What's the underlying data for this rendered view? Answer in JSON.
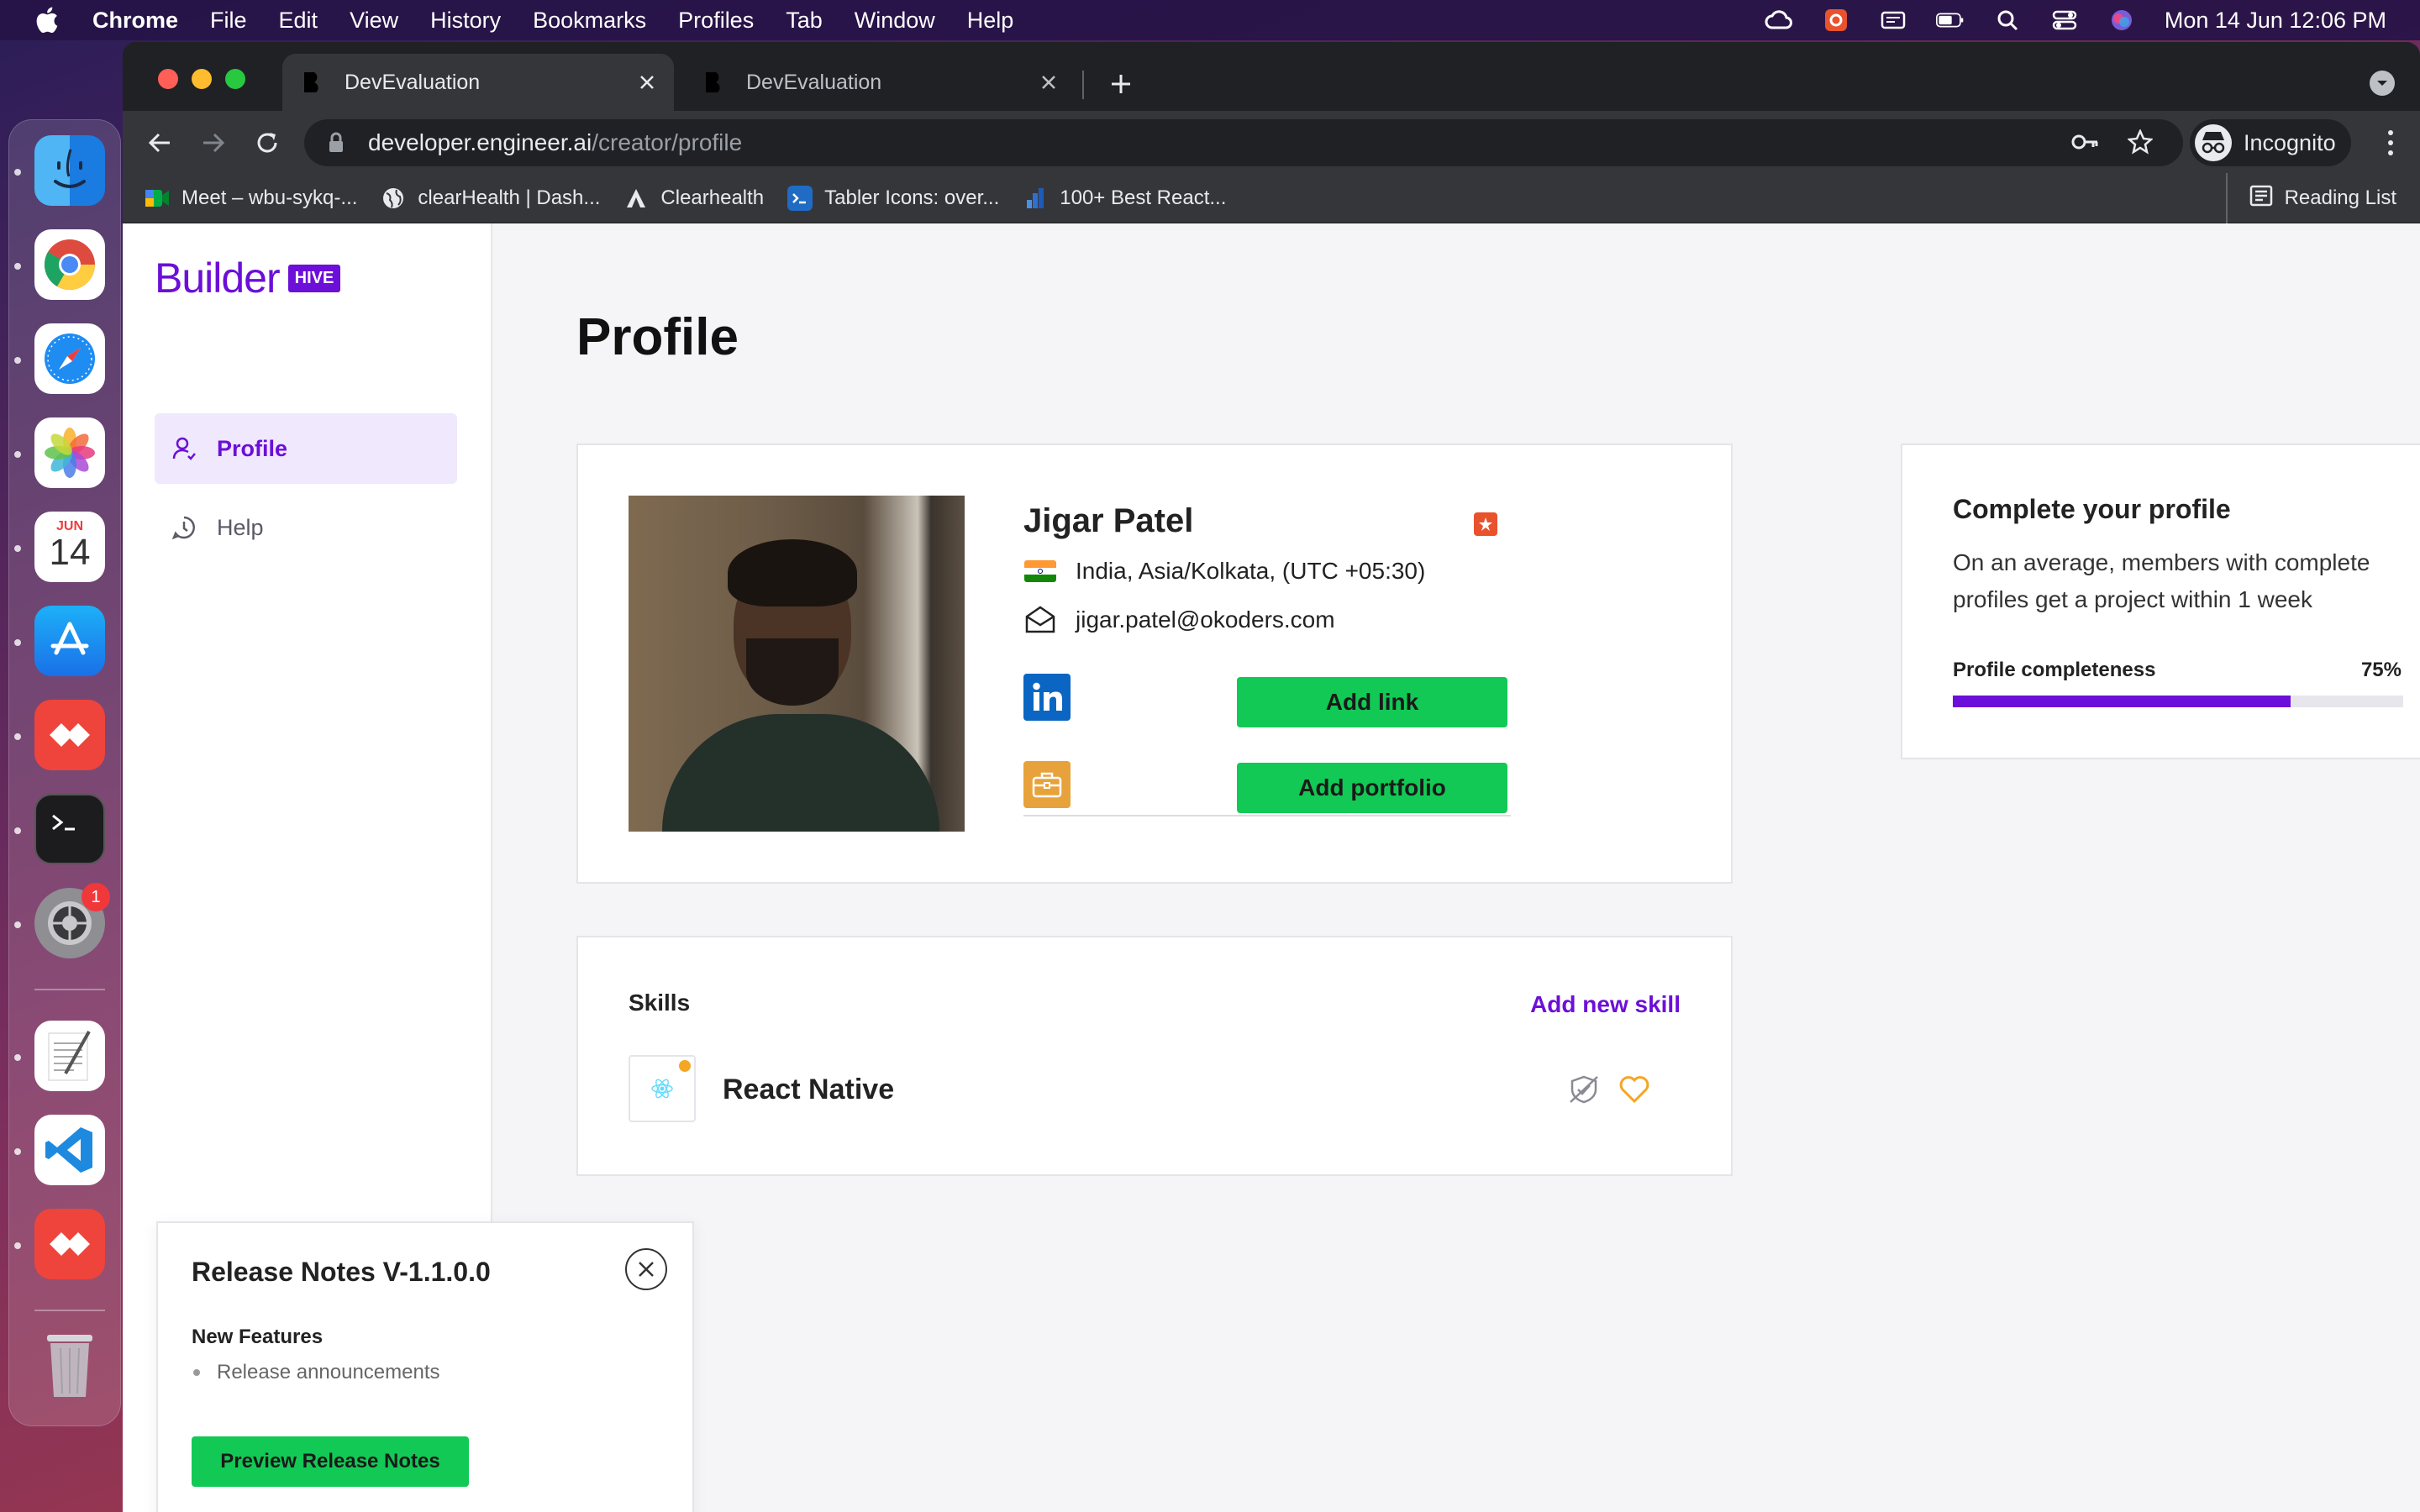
{
  "menubar": {
    "app": "Chrome",
    "items": [
      "File",
      "Edit",
      "View",
      "History",
      "Bookmarks",
      "Profiles",
      "Tab",
      "Window",
      "Help"
    ],
    "datetime": "Mon 14 Jun  12:06 PM"
  },
  "dock": {
    "apps": [
      "finder-icon",
      "chrome-icon",
      "safari-icon",
      "photos-icon",
      "calendar-icon",
      "app-store-icon",
      "anydesk-icon",
      "terminal-icon",
      "system-preferences-icon",
      "textedit-icon",
      "vscode-icon",
      "anydesk-icon",
      "trash-icon"
    ],
    "calendar_month": "JUN",
    "calendar_day": "14",
    "system_prefs_badge": "1"
  },
  "browser": {
    "tabs": [
      {
        "title": "DevEvaluation",
        "active": true
      },
      {
        "title": "DevEvaluation",
        "active": false
      }
    ],
    "url_host": "developer.engineer.ai",
    "url_path": "/creator/profile",
    "profile_label": "Incognito",
    "bookmarks": [
      {
        "label": "Meet – wbu-sykq-...",
        "icon": "google-meet-icon"
      },
      {
        "label": "clearHealth | Dash...",
        "icon": "globe-icon"
      },
      {
        "label": "Clearhealth",
        "icon": "clearhealth-icon"
      },
      {
        "label": "Tabler Icons: over...",
        "icon": "tabler-icon"
      },
      {
        "label": "100+ Best React...",
        "icon": "bookmark-icon"
      }
    ],
    "reading_list": "Reading List"
  },
  "sidebar": {
    "logo_word": "Builder",
    "logo_badge": "HIVE",
    "items": [
      {
        "label": "Profile",
        "active": true
      },
      {
        "label": "Help",
        "active": false
      }
    ]
  },
  "main": {
    "title": "Profile",
    "profile": {
      "name": "Jigar Patel",
      "location": "India, Asia/Kolkata, (UTC +05:30)",
      "email": "jigar.patel@okoders.com",
      "add_link_label": "Add link",
      "add_portfolio_label": "Add portfolio"
    },
    "completion": {
      "title": "Complete your profile",
      "text": "On an average, members with complete profiles get a project within 1 week",
      "label": "Profile completeness",
      "percent_text": "75%",
      "percent": 75
    },
    "skills": {
      "title": "Skills",
      "add_label": "Add new skill",
      "items": [
        {
          "name": "React Native"
        }
      ]
    }
  },
  "release_notes": {
    "title": "Release Notes V-1.1.0.0",
    "subtitle": "New Features",
    "items": [
      "Release announcements"
    ],
    "button": "Preview Release Notes"
  },
  "colors": {
    "brand": "#6c0fd8",
    "green": "#12c955",
    "linkedin": "#0a66c2",
    "portfolio": "#e8a23c"
  }
}
